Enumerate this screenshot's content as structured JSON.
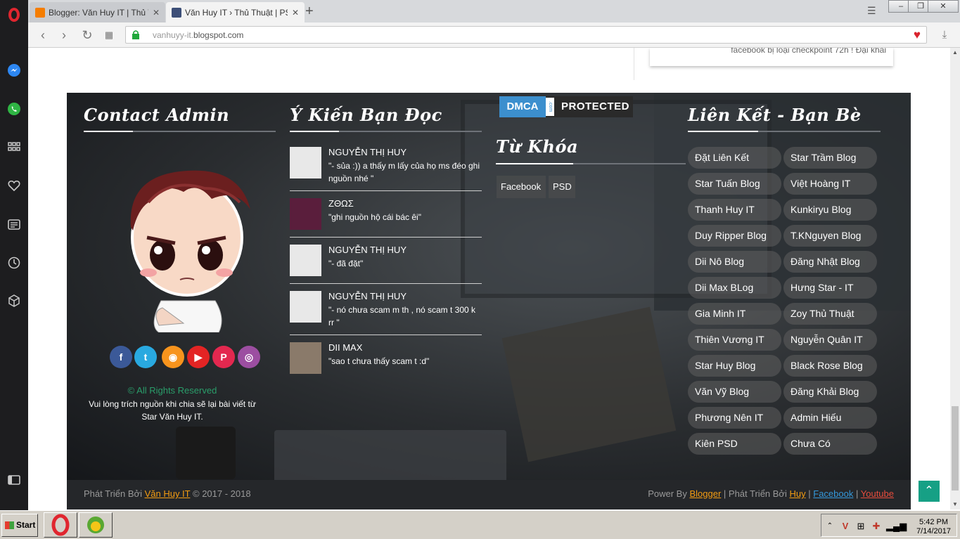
{
  "browser": {
    "tabs": [
      {
        "title": "Blogger: Văn Huy IT | Thủ Thuật",
        "active": false
      },
      {
        "title": "Văn Huy IT › Thủ Thuật | PSD",
        "active": true
      }
    ],
    "new_tab": "+",
    "url_grey": "vanhuyy-it.",
    "url_main": "blogspot.com",
    "window_controls": {
      "minimize": "–",
      "restore": "❐",
      "close": "✕"
    }
  },
  "page": {
    "top_snippet": "facebook bị loại checkpoint 72h ! Đại khái",
    "contact": {
      "title": "Contact Admin",
      "social": [
        {
          "icon": "facebook-icon",
          "glyph": "f",
          "color": "#3b5998"
        },
        {
          "icon": "twitter-icon",
          "glyph": "t",
          "color": "#29a9e0"
        },
        {
          "icon": "rss-icon",
          "glyph": "◉",
          "color": "#f7941d"
        },
        {
          "icon": "youtube-icon",
          "glyph": "▶",
          "color": "#e32424"
        },
        {
          "icon": "pinterest-icon",
          "glyph": "P",
          "color": "#e3284f"
        },
        {
          "icon": "tripadvisor-icon",
          "glyph": "◎",
          "color": "#9c4ea1"
        }
      ],
      "copyright": "© All Rights Reserved",
      "message": "Vui lòng trích nguồn khi chia sẽ lại bài viết từ Star Văn Huy IT."
    },
    "comments": {
      "title": "Ý Kiến Bạn Đọc",
      "items": [
        {
          "name": "NGUYỄN THỊ HUY",
          "text": "\"- sủa :)) a thấy m lấy của họ ms đéo ghi nguồn nhé \""
        },
        {
          "name": "ZΘΩΣ",
          "text": "\"ghi nguồn hộ cái bác êi\""
        },
        {
          "name": "NGUYỄN THỊ HUY",
          "text": "\"- đã đặt\""
        },
        {
          "name": "NGUYỄN THỊ HUY",
          "text": "\"- nó chưa scam m th , nó scam t 300 k rr \""
        },
        {
          "name": "DII MAX",
          "text": "\"sao t chưa thấy scam t :d\""
        }
      ]
    },
    "dmca": {
      "left": "DMCA",
      "com": ".com",
      "right": "PROTECTED"
    },
    "keywords": {
      "title": "Từ Khóa",
      "tags": [
        "Facebook",
        "PSD"
      ]
    },
    "links": {
      "title": "Liên Kết - Bạn Bè",
      "left": [
        "Đặt Liên Kết",
        "Star Tuấn Blog",
        "Thanh Huy IT",
        "Duy Ripper Blog",
        "Dii Nô Blog",
        "Dii Max BLog",
        "Gia Minh IT",
        "Thiên Vương IT",
        "Star Huy Blog",
        "Văn Vỹ Blog",
        "Phương Nên IT",
        "Kiên PSD"
      ],
      "right": [
        "Star Trầm Blog",
        "Việt Hoàng IT",
        "Kunkiryu Blog",
        "T.KNguyen Blog",
        "Đăng Nhật Blog",
        "Hưng Star - IT",
        "Zoy Thủ Thuật",
        "Nguyễn Quân IT",
        "Black Rose Blog",
        "Đăng Khải Blog",
        "Admin Hiếu",
        "Chưa Có"
      ]
    },
    "bottom": {
      "left_prefix": "Phát Triển Bởi",
      "left_link": "Văn Huy IT",
      "left_suffix": "© 2017 - 2018",
      "power_by": "Power By",
      "blogger": "Blogger",
      "sep1": "| Phát Triển Bởi",
      "huy": "Huy",
      "sep2": "|",
      "facebook": "Facebook",
      "sep3": "|",
      "youtube": "Youtube"
    }
  },
  "taskbar": {
    "start": "Start",
    "time": "5:42 PM",
    "date": "7/14/2017"
  },
  "colors": {
    "accent_orange": "#f39c12",
    "accent_blue": "#3498db",
    "accent_red": "#e74c3c",
    "back_to_top": "#16a085"
  }
}
